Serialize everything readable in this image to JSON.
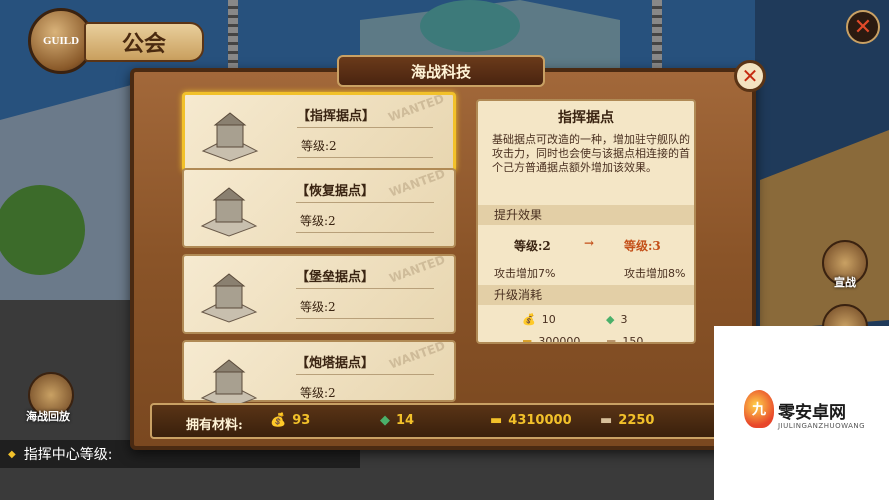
{
  "guild": {
    "badge_text": "GUILD",
    "title": "公会"
  },
  "window": {
    "title": "海战科技",
    "close_icon": "close-icon"
  },
  "cards": [
    {
      "name": "【指挥据点】",
      "level": "等级:2",
      "selected": true,
      "stamp": "WANTED"
    },
    {
      "name": "【恢复据点】",
      "level": "等级:2",
      "selected": false,
      "stamp": "WANTED"
    },
    {
      "name": "【堡垒据点】",
      "level": "等级:2",
      "selected": false,
      "stamp": "WANTED"
    },
    {
      "name": "【炮塔据点】",
      "level": "等级:2",
      "selected": false,
      "stamp": "WANTED"
    }
  ],
  "detail": {
    "title": "指挥据点",
    "description": "基础据点可改造的一种，增加驻守舰队的攻击力，同时也会使与该据点相连接的首个己方普通据点额外增加该效果。",
    "upgrade_effect_label": "提升效果",
    "current_level": "等级:2",
    "arrow": "→",
    "next_level": "等级:3",
    "current_effect": "攻击增加7%",
    "next_effect": "攻击增加8%",
    "cost_label": "升级消耗",
    "costs": [
      {
        "icon": "coin-bag-icon",
        "value": "10"
      },
      {
        "icon": "green-crystal-icon",
        "value": "3"
      },
      {
        "icon": "gold-bar-icon",
        "value": "300000"
      },
      {
        "icon": "plank-icon",
        "value": "150"
      }
    ]
  },
  "materials": {
    "label": "拥有材料:",
    "items": [
      {
        "icon": "coin-bag-icon",
        "value": "93"
      },
      {
        "icon": "green-crystal-icon",
        "value": "14"
      },
      {
        "icon": "gold-bar-icon",
        "value": "4310000"
      },
      {
        "icon": "plank-icon",
        "value": "2250"
      }
    ]
  },
  "side": {
    "left_label": "海战回放",
    "right_label": "宣战"
  },
  "footer": {
    "hq_label": "指挥中心等级:"
  },
  "watermark": {
    "text": "零安卓网",
    "sub": "JIULINGANZHUOWANG"
  },
  "colors": {
    "accent": "#f2c12a",
    "next_level": "#c4501a",
    "wood": "#8a5428"
  }
}
